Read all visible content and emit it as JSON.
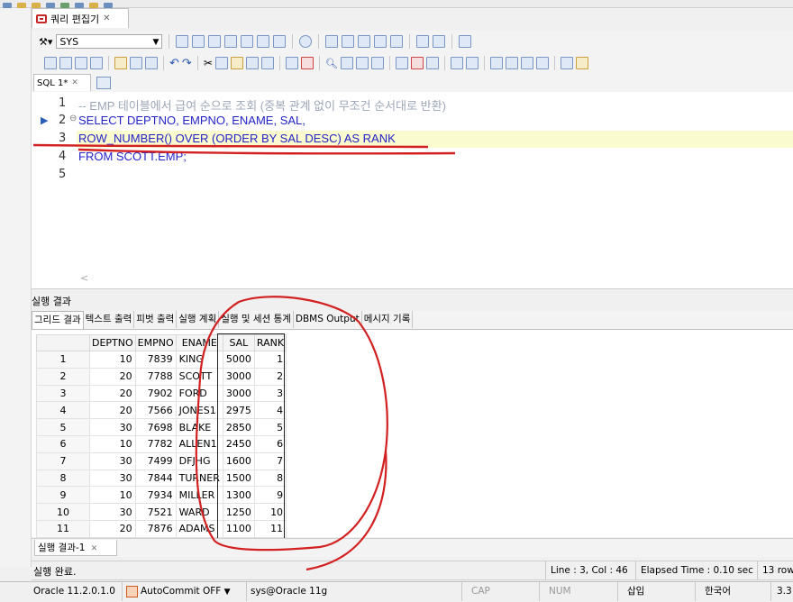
{
  "window": {
    "editor_tab_label": "쿼리 편집기"
  },
  "toolbar": {
    "schema_value": "SYS"
  },
  "sql_tab": {
    "label": "SQL 1*"
  },
  "editor": {
    "lines": [
      {
        "no": "1",
        "text": "-- EMP 테이블에서 급여 순으로 조회 (중복 관계 없이 무조건 순서대로 반환)"
      },
      {
        "no": "2",
        "text": "SELECT DEPTNO, EMPNO, ENAME, SAL,"
      },
      {
        "no": "3",
        "text": "ROW_NUMBER() OVER (ORDER BY SAL DESC) AS RANK"
      },
      {
        "no": "4",
        "text": "FROM SCOTT.EMP;"
      },
      {
        "no": "5",
        "text": ""
      }
    ]
  },
  "results": {
    "panel_title": "실행 결과",
    "tabs": [
      "그리드 결과",
      "텍스트 출력",
      "피벗 출력",
      "실행 계획",
      "실행 및 세션 통계",
      "DBMS Output",
      "메시지 기록"
    ],
    "columns": [
      "DEPTNO",
      "EMPNO",
      "ENAME",
      "SAL",
      "RANK"
    ],
    "rows": [
      [
        "1",
        "10",
        "7839",
        "KING",
        "5000",
        "1"
      ],
      [
        "2",
        "20",
        "7788",
        "SCOTT",
        "3000",
        "2"
      ],
      [
        "3",
        "20",
        "7902",
        "FORD",
        "3000",
        "3"
      ],
      [
        "4",
        "20",
        "7566",
        "JONES1",
        "2975",
        "4"
      ],
      [
        "5",
        "30",
        "7698",
        "BLAKE",
        "2850",
        "5"
      ],
      [
        "6",
        "10",
        "7782",
        "ALLEN1",
        "2450",
        "6"
      ],
      [
        "7",
        "30",
        "7499",
        "DFJHG",
        "1600",
        "7"
      ],
      [
        "8",
        "30",
        "7844",
        "TURNER",
        "1500",
        "8"
      ],
      [
        "9",
        "10",
        "7934",
        "MILLER",
        "1300",
        "9"
      ],
      [
        "10",
        "30",
        "7521",
        "WARD",
        "1250",
        "10"
      ],
      [
        "11",
        "20",
        "7876",
        "ADAMS",
        "1100",
        "11"
      ]
    ],
    "bottom_tab": "실행 결과-1"
  },
  "status": {
    "message": "실행 완료.",
    "position": "Line : 3, Col : 46",
    "elapsed": "Elapsed Time : 0.10 sec",
    "rows": "13 row"
  },
  "footer": {
    "oracle_version": "Oracle 11.2.0.1.0",
    "autocommit": "AutoCommit OFF",
    "connection": "sys@Oracle 11g",
    "cap": "CAP",
    "num": "NUM",
    "insert": "삽입",
    "lang": "한국어",
    "extra": "3.3"
  },
  "colors": {
    "keyword": "#2323c8",
    "annotation": "#d32020"
  }
}
